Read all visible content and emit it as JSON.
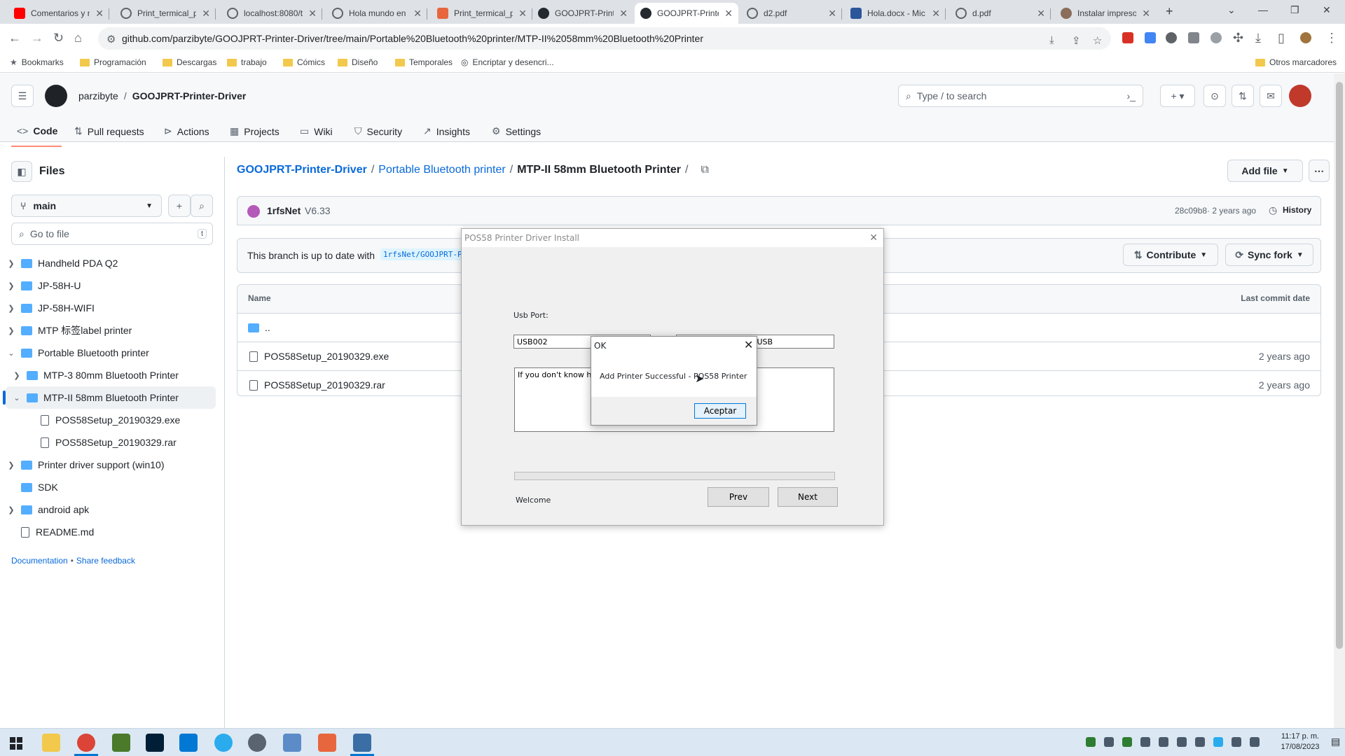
{
  "browser": {
    "tabs": [
      {
        "title": "Comentarios y n",
        "favicon": "youtube-icon",
        "color": "#ff0000"
      },
      {
        "title": "Print_termical_p",
        "favicon": "globe-icon",
        "color": "#5f6368"
      },
      {
        "title": "localhost:8080/t",
        "favicon": "globe-icon",
        "color": "#5f6368"
      },
      {
        "title": "Hola mundo en",
        "favicon": "globe-icon",
        "color": "#5f6368"
      },
      {
        "title": "Print_termical_p",
        "favicon": "app-icon",
        "color": "#e8663d"
      },
      {
        "title": "GOOJPRT-Printe",
        "favicon": "github-icon",
        "color": "#24292f"
      },
      {
        "title": "GOOJPRT-Printe",
        "favicon": "github-icon",
        "color": "#24292f",
        "active": true
      },
      {
        "title": "d2.pdf",
        "favicon": "globe-icon",
        "color": "#5f6368"
      },
      {
        "title": "Hola.docx - Mic",
        "favicon": "word-icon",
        "color": "#2b579a"
      },
      {
        "title": "d.pdf",
        "favicon": "globe-icon",
        "color": "#5f6368"
      },
      {
        "title": "Instalar impreso",
        "favicon": "avatar-icon",
        "color": "#8a6d5a"
      }
    ],
    "url": "github.com/parzibyte/GOOJPRT-Printer-Driver/tree/main/Portable%20Bluetooth%20printer/MTP-II%2058mm%20Bluetooth%20Printer",
    "bookmarks": [
      "Bookmarks",
      "Programación",
      "Descargas",
      "trabajo",
      "Cómics",
      "Diseño",
      "Temporales",
      "Encriptar y desencri...",
      "Otros marcadores"
    ]
  },
  "github": {
    "owner": "parzibyte",
    "repo": "GOOJPRT-Printer-Driver",
    "search_placeholder": "Type / to search",
    "nav": [
      "Code",
      "Pull requests",
      "Actions",
      "Projects",
      "Wiki",
      "Security",
      "Insights",
      "Settings"
    ],
    "sidebar": {
      "title": "Files",
      "branch": "main",
      "goto_placeholder": "Go to file",
      "goto_shortcut": "t",
      "tree": [
        {
          "label": "Handheld PDA Q2",
          "type": "dir",
          "depth": 0,
          "state": "collapsed"
        },
        {
          "label": "JP-58H-U",
          "type": "dir",
          "depth": 0,
          "state": "collapsed"
        },
        {
          "label": "JP-58H-WIFI",
          "type": "dir",
          "depth": 0,
          "state": "collapsed"
        },
        {
          "label": "MTP 标签label printer",
          "type": "dir",
          "depth": 0,
          "state": "collapsed"
        },
        {
          "label": "Portable Bluetooth printer",
          "type": "dir",
          "depth": 0,
          "state": "expanded"
        },
        {
          "label": "MTP-3 80mm Bluetooth Printer",
          "type": "dir",
          "depth": 1,
          "state": "collapsed"
        },
        {
          "label": "MTP-II 58mm Bluetooth Printer",
          "type": "dir",
          "depth": 1,
          "state": "expanded",
          "selected": true
        },
        {
          "label": "POS58Setup_20190329.exe",
          "type": "file",
          "depth": 2
        },
        {
          "label": "POS58Setup_20190329.rar",
          "type": "file",
          "depth": 2
        },
        {
          "label": "Printer driver support (win10)",
          "type": "dir",
          "depth": 0,
          "state": "collapsed"
        },
        {
          "label": "SDK",
          "type": "dir",
          "depth": 0,
          "state": "none"
        },
        {
          "label": "android apk",
          "type": "dir",
          "depth": 0,
          "state": "collapsed"
        },
        {
          "label": "README.md",
          "type": "file",
          "depth": 0
        }
      ],
      "footer_docs": "Documentation",
      "footer_sep": "•",
      "footer_feedback": "Share feedback"
    },
    "breadcrumb": {
      "repo": "GOOJPRT-Printer-Driver",
      "folder": "Portable Bluetooth printer",
      "current": "MTP-II 58mm Bluetooth Printer",
      "sep": "/"
    },
    "add_file": "Add file",
    "commit": {
      "author": "1rfsNet",
      "message": "V6.33",
      "sha": "28c09b8",
      "age": "· 2 years ago",
      "history": "History"
    },
    "branch_status": {
      "text": "This branch is up to date with",
      "ref": "1rfsNet/GOOJPRT-P"
    },
    "contribute": "Contribute",
    "sync_fork": "Sync fork",
    "table": {
      "col_name": "Name",
      "col_date": "Last commit date",
      "parent": "..",
      "rows": [
        {
          "name": "POS58Setup_20190329.exe",
          "date": "2 years ago"
        },
        {
          "name": "POS58Setup_20190329.rar",
          "date": "2 years ago"
        }
      ]
    }
  },
  "installer": {
    "title": "POS58 Printer Driver Install",
    "usb_label": "Usb Port:",
    "usb_value": "USB002",
    "port_value": "h USB",
    "info_text": "If you don't know how",
    "status": "Welcome",
    "prev": "Prev",
    "next": "Next"
  },
  "msgbox": {
    "title": "OK",
    "message": "Add Printer Successful - POS58 Printer",
    "button": "Aceptar"
  },
  "taskbar": {
    "time": "11:17 p. m.",
    "date": "17/08/2023",
    "apps": [
      "windows-start-icon",
      "file-explorer-icon",
      "chrome-icon",
      "lambda-app-icon",
      "photoshop-icon",
      "vscode-icon",
      "telegram-icon",
      "settings-gear-icon",
      "window-app-icon",
      "app-c-icon",
      "window-app-icon"
    ]
  }
}
